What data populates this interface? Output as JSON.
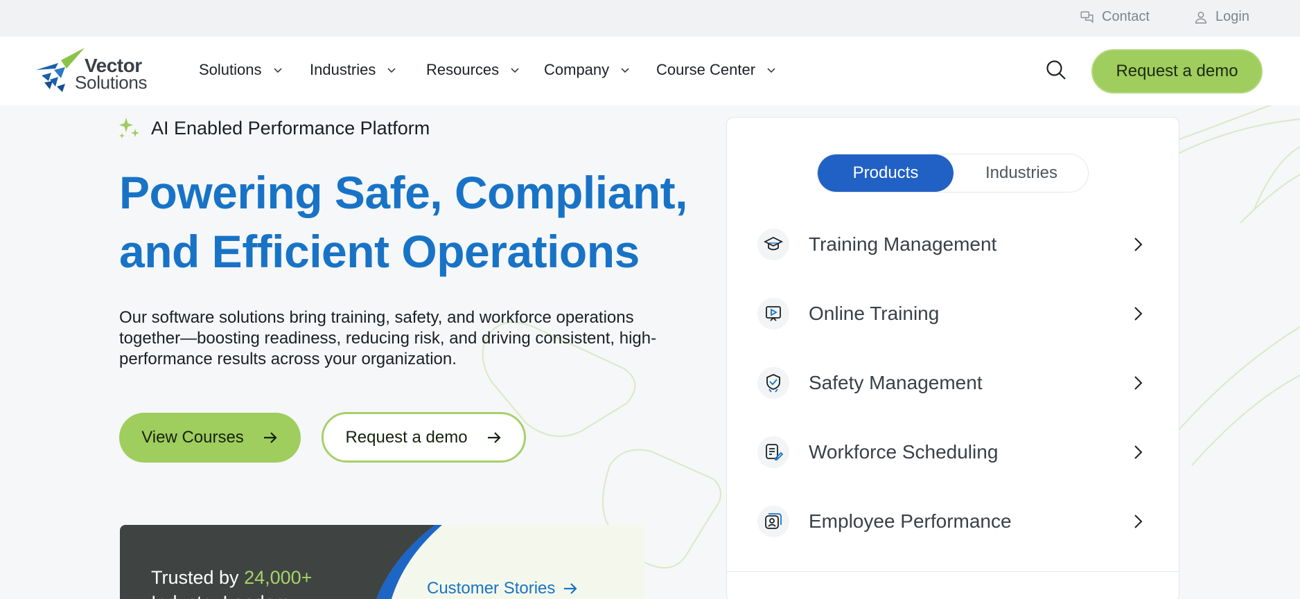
{
  "utility": {
    "contact_label": "Contact",
    "login_label": "Login"
  },
  "brand": {
    "logo_line1": "Vector",
    "logo_line2": "Solutions",
    "colors": {
      "primary_blue": "#1873c6",
      "accent_green": "#9fcd5e",
      "toggle_blue": "#2161c5"
    }
  },
  "nav": {
    "items": [
      {
        "label": "Solutions"
      },
      {
        "label": "Industries"
      },
      {
        "label": "Resources"
      },
      {
        "label": "Company"
      },
      {
        "label": "Course Center"
      }
    ],
    "search_icon": "search-icon",
    "demo_label": "Request a demo"
  },
  "hero": {
    "badge": "AI Enabled Performance Platform",
    "title_line1": "Powering Safe, Compliant,",
    "title_line2": "and Efficient Operations",
    "description": "Our software solutions bring training, safety, and workforce operations together—boosting readiness, reducing risk, and driving consistent, high-performance results across your organization.",
    "view_courses_label": "View Courses",
    "request_demo_label": "Request a demo"
  },
  "trust": {
    "prefix": "Trusted by ",
    "number": "24,000+",
    "line2": "Industry Leaders",
    "stories_label": "Customer Stories"
  },
  "panel": {
    "tabs": [
      {
        "label": "Products",
        "active": true
      },
      {
        "label": "Industries",
        "active": false
      }
    ],
    "products": [
      {
        "label": "Training Management",
        "icon": "graduation-cap-icon"
      },
      {
        "label": "Online Training",
        "icon": "video-play-icon"
      },
      {
        "label": "Safety Management",
        "icon": "shield-check-icon"
      },
      {
        "label": "Workforce Scheduling",
        "icon": "schedule-edit-icon"
      },
      {
        "label": "Employee Performance",
        "icon": "employee-badge-icon"
      }
    ]
  }
}
